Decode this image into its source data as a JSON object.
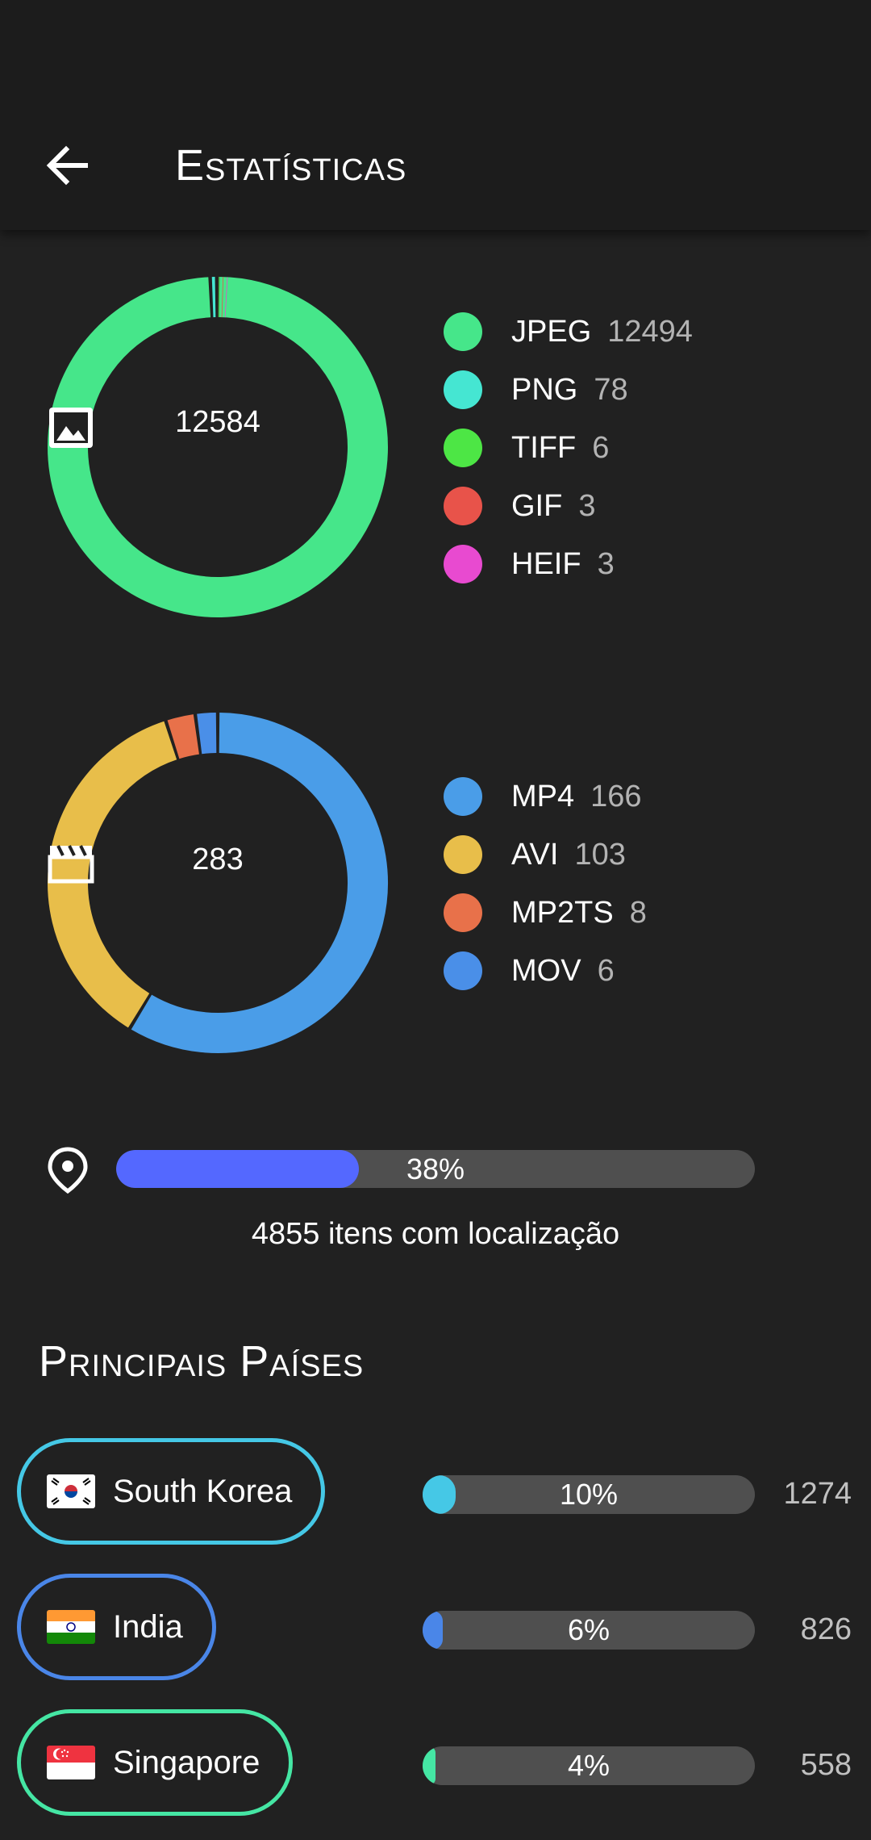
{
  "header": {
    "title": "Estatísticas",
    "back_icon": "arrow-back-icon"
  },
  "images": {
    "icon": "image-icon",
    "total": "12584",
    "legend": [
      {
        "label": "JPEG",
        "value": "12494",
        "color": "#46e68a"
      },
      {
        "label": "PNG",
        "value": "78",
        "color": "#45e6d2"
      },
      {
        "label": "TIFF",
        "value": "6",
        "color": "#4de645"
      },
      {
        "label": "GIF",
        "value": "3",
        "color": "#e8534a"
      },
      {
        "label": "HEIF",
        "value": "3",
        "color": "#e84ad0"
      }
    ]
  },
  "videos": {
    "icon": "clapperboard-icon",
    "total": "283",
    "legend": [
      {
        "label": "MP4",
        "value": "166",
        "color": "#4a9de8"
      },
      {
        "label": "AVI",
        "value": "103",
        "color": "#e8be4a"
      },
      {
        "label": "MP2TS",
        "value": "8",
        "color": "#e8714a"
      },
      {
        "label": "MOV",
        "value": "6",
        "color": "#4a8fe8"
      }
    ]
  },
  "location": {
    "icon": "location-pin-icon",
    "percent_label": "38%",
    "fraction": 0.38,
    "color": "#5468ff",
    "caption": "4855 itens com localização"
  },
  "countries": {
    "title": "Principais Países",
    "items": [
      {
        "name": "South Korea",
        "flag": "south-korea-flag-icon",
        "percent_label": "10%",
        "fraction": 0.1,
        "count": "1274",
        "color": "#45c8e6"
      },
      {
        "name": "India",
        "flag": "india-flag-icon",
        "percent_label": "6%",
        "fraction": 0.06,
        "count": "826",
        "color": "#4a86e8"
      },
      {
        "name": "Singapore",
        "flag": "singapore-flag-icon",
        "percent_label": "4%",
        "fraction": 0.04,
        "count": "558",
        "color": "#45e6a4"
      }
    ]
  }
}
